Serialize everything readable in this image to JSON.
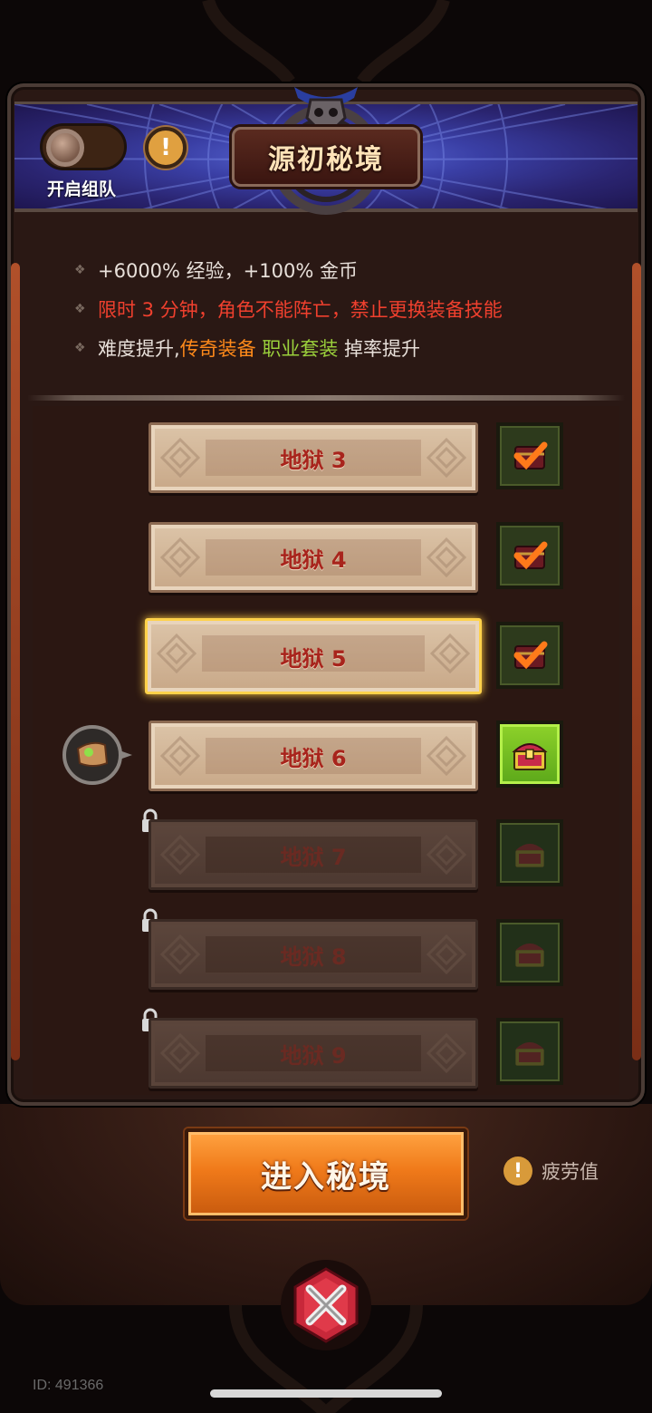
{
  "header": {
    "title": "源初秘境",
    "team_toggle_label": "开启组队",
    "team_toggle_on": false,
    "info_symbol": "!"
  },
  "rules": [
    {
      "segments": [
        {
          "text": "+6000% 经验，+100% 金币",
          "color": "white"
        }
      ]
    },
    {
      "segments": [
        {
          "text": "限时 3 分钟，角色不能阵亡，禁止更换装备技能",
          "color": "red"
        }
      ]
    },
    {
      "segments": [
        {
          "text": "难度提升,",
          "color": "white"
        },
        {
          "text": "传奇装备 ",
          "color": "orange"
        },
        {
          "text": "职业套装",
          "color": "green"
        },
        {
          "text": " 掉率提升",
          "color": "white"
        }
      ]
    }
  ],
  "levels": [
    {
      "label": "地狱 3",
      "state": "cleared",
      "reward": "claimed"
    },
    {
      "label": "地狱 4",
      "state": "cleared",
      "reward": "claimed"
    },
    {
      "label": "地狱 5",
      "state": "selected",
      "reward": "claimed"
    },
    {
      "label": "地狱 6",
      "state": "current",
      "reward": "available"
    },
    {
      "label": "地狱 7",
      "state": "locked",
      "reward": "locked"
    },
    {
      "label": "地狱 8",
      "state": "locked",
      "reward": "locked"
    },
    {
      "label": "地狱 9",
      "state": "locked",
      "reward": "locked"
    }
  ],
  "actions": {
    "enter_label": "进入秘境",
    "fatigue_label": "疲劳值",
    "fatigue_icon": "!"
  },
  "footer": {
    "player_id": "ID: 491366"
  },
  "colors": {
    "accent_orange": "#f07a1a",
    "rule_red": "#f0402e",
    "legendary_orange": "#ff8a1a",
    "set_green": "#9bd13c",
    "banner_blue": "#3a3fa5"
  }
}
